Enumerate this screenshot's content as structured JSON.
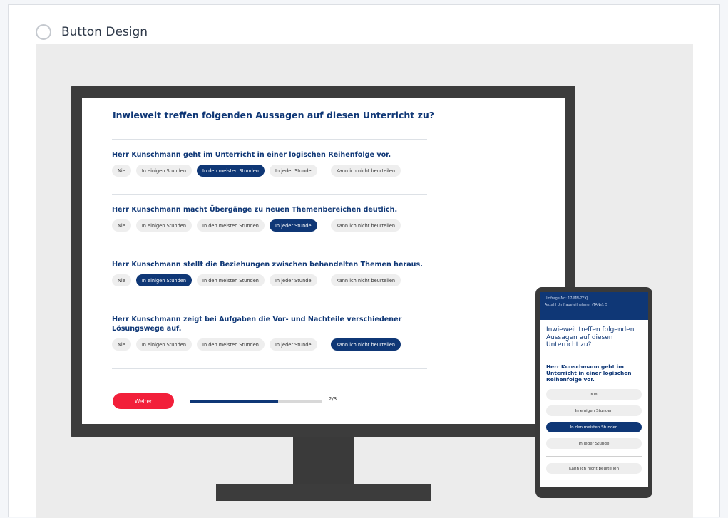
{
  "option": {
    "label": "Button Design",
    "selected": false
  },
  "survey": {
    "title": "Inwieweit treffen folgenden Aussagen auf diesen Unterricht zu?",
    "options": [
      "Nie",
      "In einigen Stunden",
      "In den meisten Stunden",
      "In jeder Stunde",
      "Kann ich nicht beurteilen"
    ],
    "questions": [
      {
        "text": "Herr Kunschmann geht im Unterricht in einer logischen Reihenfolge vor.",
        "selected": 2
      },
      {
        "text": "Herr Kunschmann macht Übergänge zu neuen Themenbereichen deutlich.",
        "selected": 3
      },
      {
        "text": "Herr Kunschmann stellt die Beziehungen zwischen behandelten Themen heraus.",
        "selected": 1
      },
      {
        "text": "Herr Kunschmann zeigt bei Aufgaben die Vor- und Nachteile verschiedener Lösungswege auf.",
        "selected": 4
      }
    ],
    "next_label": "Weiter",
    "progress": {
      "fraction": 0.67,
      "text": "2/3"
    }
  },
  "phone": {
    "header_line1": "Umfrage-Nr.: 17-MN-ZFXJ",
    "header_line2": "Anzahl Umfrageteilnehmer (TANs): 5",
    "title": "Inwieweit treffen folgenden Aussagen auf diesen Unterricht zu?",
    "question": "Herr Kunschmann geht im Unterricht in einer logischen Reihenfolge vor.",
    "selected": 2
  },
  "colors": {
    "brand_blue": "#0f3776",
    "accent_red": "#f21f3a",
    "pill_gray": "#eeeeee"
  }
}
